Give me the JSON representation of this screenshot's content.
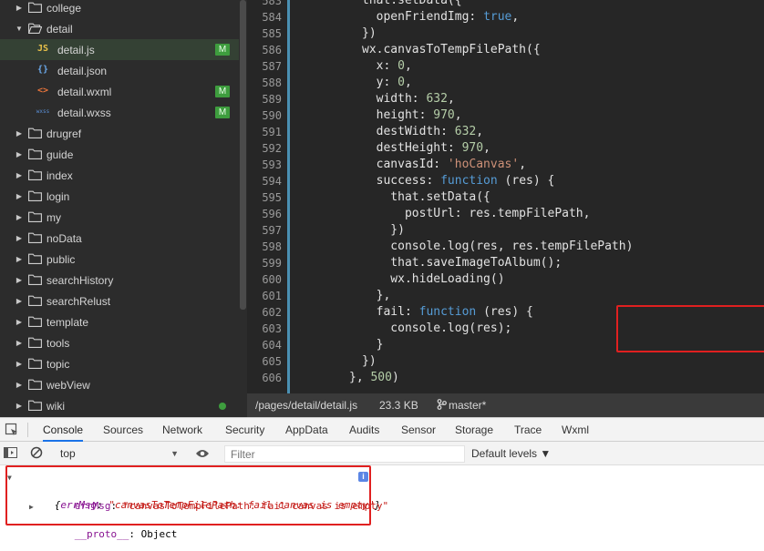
{
  "file_tree": {
    "items": [
      {
        "label": "college",
        "type": "folder",
        "expanded": false,
        "indent": 0
      },
      {
        "label": "detail",
        "type": "folder",
        "expanded": true,
        "indent": 0
      },
      {
        "label": "detail.js",
        "type": "js",
        "icon_text": "JS",
        "badge": "M",
        "selected": true
      },
      {
        "label": "detail.json",
        "type": "json",
        "icon_text": "{}"
      },
      {
        "label": "detail.wxml",
        "type": "wxml",
        "icon_text": "<>",
        "badge": "M"
      },
      {
        "label": "detail.wxss",
        "type": "wxss",
        "icon_text": "wxss",
        "badge": "M"
      },
      {
        "label": "drugref",
        "type": "folder"
      },
      {
        "label": "guide",
        "type": "folder"
      },
      {
        "label": "index",
        "type": "folder"
      },
      {
        "label": "login",
        "type": "folder"
      },
      {
        "label": "my",
        "type": "folder"
      },
      {
        "label": "noData",
        "type": "folder"
      },
      {
        "label": "public",
        "type": "folder"
      },
      {
        "label": "searchHistory",
        "type": "folder"
      },
      {
        "label": "searchRelust",
        "type": "folder"
      },
      {
        "label": "template",
        "type": "folder"
      },
      {
        "label": "tools",
        "type": "folder"
      },
      {
        "label": "topic",
        "type": "folder"
      },
      {
        "label": "webView",
        "type": "folder"
      },
      {
        "label": "wiki",
        "type": "folder",
        "dot": true
      }
    ]
  },
  "editor": {
    "line_numbers": [
      "583",
      "584",
      "585",
      "586",
      "587",
      "588",
      "589",
      "590",
      "591",
      "592",
      "593",
      "594",
      "595",
      "596",
      "597",
      "598",
      "599",
      "600",
      "601",
      "602",
      "603",
      "604",
      "605",
      "606"
    ],
    "lines": [
      [
        [
          "",
          "that.setData({"
        ]
      ],
      [
        [
          "",
          "  openFriendImg: "
        ],
        [
          "bool",
          "true"
        ],
        [
          "",
          ","
        ]
      ],
      [
        [
          "",
          "})"
        ]
      ],
      [
        [
          "",
          "wx.canvasToTempFilePath({"
        ]
      ],
      [
        [
          "",
          "  x: "
        ],
        [
          "num",
          "0"
        ],
        [
          "",
          ","
        ]
      ],
      [
        [
          "",
          "  y: "
        ],
        [
          "num",
          "0"
        ],
        [
          "",
          ","
        ]
      ],
      [
        [
          "",
          "  width: "
        ],
        [
          "num",
          "632"
        ],
        [
          "",
          ","
        ]
      ],
      [
        [
          "",
          "  height: "
        ],
        [
          "num",
          "970"
        ],
        [
          "",
          ","
        ]
      ],
      [
        [
          "",
          "  destWidth: "
        ],
        [
          "num",
          "632"
        ],
        [
          "",
          ","
        ]
      ],
      [
        [
          "",
          "  destHeight: "
        ],
        [
          "num",
          "970"
        ],
        [
          "",
          ","
        ]
      ],
      [
        [
          "",
          "  canvasId: "
        ],
        [
          "str",
          "'hoCanvas'"
        ],
        [
          "",
          ","
        ]
      ],
      [
        [
          "",
          "  success: "
        ],
        [
          "kw",
          "function"
        ],
        [
          "",
          " (res) {"
        ]
      ],
      [
        [
          "",
          "    that.setData({"
        ]
      ],
      [
        [
          "",
          "      postUrl: res.tempFilePath,"
        ]
      ],
      [
        [
          "",
          "    })"
        ]
      ],
      [
        [
          "",
          "    console.log(res, res.tempFilePath)"
        ]
      ],
      [
        [
          "",
          "    that.saveImageToAlbum();"
        ]
      ],
      [
        [
          "",
          "    wx.hideLoading()"
        ]
      ],
      [
        [
          "",
          "  },"
        ]
      ],
      [
        [
          "",
          "  fail: "
        ],
        [
          "kw",
          "function"
        ],
        [
          "",
          " (res) {"
        ]
      ],
      [
        [
          "",
          "    console.log(res);"
        ]
      ],
      [
        [
          "",
          "  }"
        ]
      ],
      [
        [
          "",
          "})"
        ]
      ],
      [
        [
          "",
          "}, "
        ],
        [
          "num",
          "500"
        ],
        [
          "",
          ")"
        ]
      ]
    ],
    "line_indents": [
      22,
      22,
      22,
      22,
      22,
      22,
      22,
      22,
      22,
      22,
      22,
      22,
      22,
      22,
      22,
      22,
      22,
      22,
      22,
      22,
      22,
      22,
      22,
      6
    ]
  },
  "statusbar": {
    "path": "/pages/detail/detail.js",
    "size": "23.3 KB",
    "branch": "master*"
  },
  "devtools": {
    "tabs": [
      "Console",
      "Sources",
      "Network",
      "Security",
      "AppData",
      "Audits",
      "Sensor",
      "Storage",
      "Trace",
      "Wxml"
    ],
    "active_tab": "Console",
    "context": "top",
    "filter_placeholder": "Filter",
    "levels": "Default levels ▼",
    "console": {
      "summary_open": "{",
      "summary_key": "errMsg",
      "summary_sep": ": ",
      "summary_value": "\"canvasToTempFilePath: fail canvas is empty\"",
      "summary_close": "}",
      "prop_key": "errMsg",
      "prop_sep": ": ",
      "prop_value": "\"canvasToTempFilePath: fail canvas is empty\"",
      "proto_key": "__proto__",
      "proto_sep": ": ",
      "proto_value": "Object",
      "info_badge": "i"
    }
  },
  "colors": {
    "highlight_box": "#e02020",
    "badge_green": "#3e9d3e",
    "selected_row": "#344134"
  }
}
